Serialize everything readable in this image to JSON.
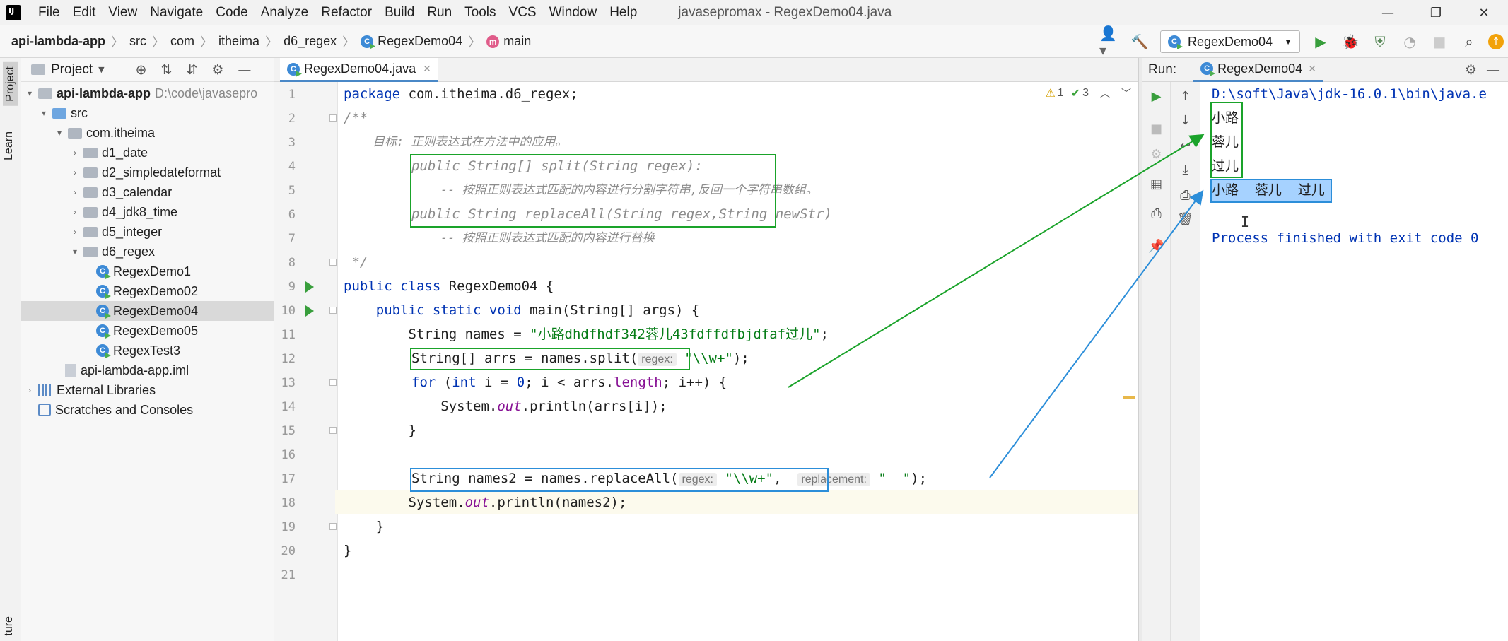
{
  "menubar": {
    "items": [
      "File",
      "Edit",
      "View",
      "Navigate",
      "Code",
      "Analyze",
      "Refactor",
      "Build",
      "Run",
      "Tools",
      "VCS",
      "Window",
      "Help"
    ],
    "window_title": "javasepromax - RegexDemo04.java"
  },
  "breadcrumb": {
    "items": [
      "api-lambda-app",
      "src",
      "com",
      "itheima",
      "d6_regex",
      "RegexDemo04",
      "main"
    ]
  },
  "toolbar": {
    "run_config": "RegexDemo04"
  },
  "left_strip": {
    "tabs": [
      "Project",
      "Learn",
      "ture"
    ]
  },
  "project": {
    "title": "Project",
    "tree": [
      {
        "label": "api-lambda-app",
        "suffix": "D:\\code\\javasepro"
      },
      {
        "label": "src"
      },
      {
        "label": "com.itheima"
      },
      {
        "label": "d1_date"
      },
      {
        "label": "d2_simpledateformat"
      },
      {
        "label": "d3_calendar"
      },
      {
        "label": "d4_jdk8_time"
      },
      {
        "label": "d5_integer"
      },
      {
        "label": "d6_regex"
      },
      {
        "label": "RegexDemo1"
      },
      {
        "label": "RegexDemo02"
      },
      {
        "label": "RegexDemo04"
      },
      {
        "label": "RegexDemo05"
      },
      {
        "label": "RegexTest3"
      },
      {
        "label": "api-lambda-app.iml"
      },
      {
        "label": "External Libraries"
      },
      {
        "label": "Scratches and Consoles"
      }
    ]
  },
  "editor": {
    "tab_label": "RegexDemo04.java",
    "status": {
      "warnings": "1",
      "checks": "3"
    },
    "line_numbers": [
      "1",
      "2",
      "3",
      "4",
      "5",
      "6",
      "7",
      "8",
      "9",
      "10",
      "11",
      "12",
      "13",
      "14",
      "15",
      "16",
      "17",
      "18",
      "19",
      "20",
      "21"
    ],
    "lines": {
      "l1_kw": "package",
      "l1_rest": " com.itheima.d6_regex;",
      "l2": "/**",
      "l3": "    目标: 正则表达式在方法中的应用。",
      "l4": "public String[] split(String regex):",
      "l5": "    -- 按照正则表达式匹配的内容进行分割字符串,反回一个字符串数组。",
      "l6": "public String replaceAll(String regex,String newStr)",
      "l7": "    -- 按照正则表达式匹配的内容进行替换",
      "l8": " */",
      "l9_kw": "public class",
      "l9_rest": " RegexDemo04 {",
      "l10_kw": "    public static void",
      "l10_rest": " main(String[] args) {",
      "l11_a": "        String names = ",
      "l11_str": "\"小路dhdfhdf342蓉儿43fdffdfbjdfaf过儿\"",
      "l11_b": ";",
      "l12_a": "String[] arrs = names.split(",
      "l12_hint": "regex:",
      "l12_str": "\"\\\\w+\"",
      "l12_b": ");",
      "l13_kw": "for",
      "l13_a": " (",
      "l13_kw2": "int",
      "l13_b": " i = ",
      "l13_num": "0",
      "l13_c": "; i < arrs.",
      "l13_fld": "length",
      "l13_d": "; i++) {",
      "l14_a": "            System.",
      "l14_out": "out",
      "l14_b": ".println(arrs[i]);",
      "l15": "        }",
      "l17_a": "String names2 = names.replaceAll(",
      "l17_hint1": "regex:",
      "l17_str1": "\"\\\\w+\"",
      "l17_comma": ",",
      "l17_hint2": "replacement:",
      "l17_str2": "\"  \"",
      "l17_b": ");",
      "l18_a": "        System.",
      "l18_out": "out",
      "l18_b": ".println(names2);",
      "l19": "    }",
      "l20": "}"
    }
  },
  "run": {
    "title": "Run:",
    "tab_label": "RegexDemo04",
    "console": {
      "cmd": "D:\\soft\\Java\\jdk-16.0.1\\bin\\java.e",
      "out1": "小路",
      "out2": "蓉儿",
      "out3": "过儿",
      "out4": "小路  蓉儿  过儿",
      "exit": "Process finished with exit code 0"
    }
  },
  "colors": {
    "annotation_green": "#1aa32a",
    "annotation_blue": "#2c8ed9",
    "keyword": "#0033b3",
    "string": "#067d17"
  }
}
